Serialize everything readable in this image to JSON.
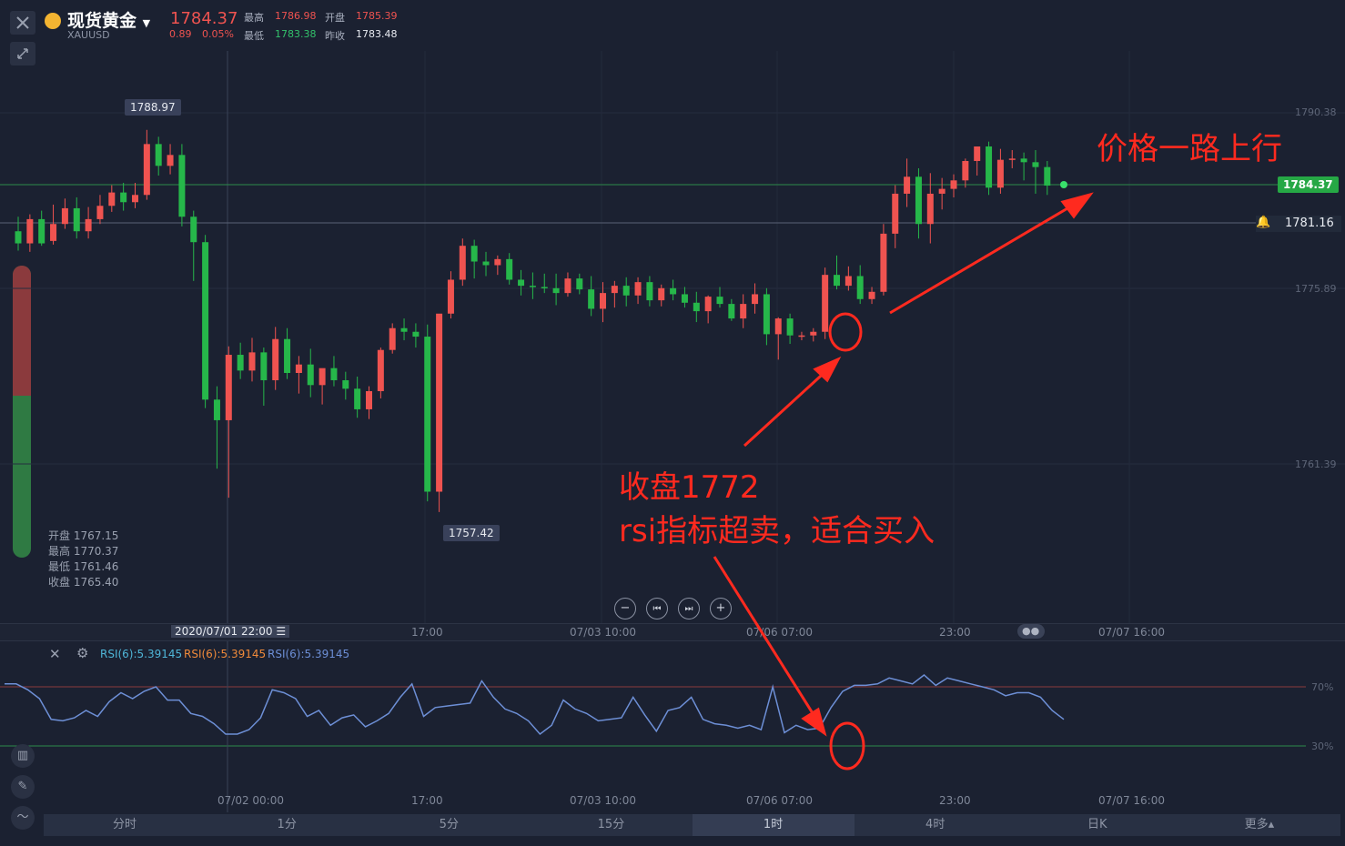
{
  "header": {
    "name": "现货黄金",
    "symbol": "XAUUSD",
    "price": "1784.37",
    "change": "0.89",
    "change_pct": "0.05%",
    "high_label": "最高",
    "high": "1786.98",
    "open_label": "开盘",
    "open": "1785.39",
    "low_label": "最低",
    "low": "1783.38",
    "prev_label": "昨收",
    "prev": "1783.48"
  },
  "price_axis": [
    "1790.38",
    "1775.89",
    "1761.39"
  ],
  "tags": {
    "high_marker": "1788.97",
    "low_marker": "1757.42",
    "current": "1784.37",
    "alert": "1781.16"
  },
  "ohlc_panel": {
    "open": "开盘 1767.15",
    "high": "最高 1770.37",
    "low": "最低 1761.46",
    "close": "收盘 1765.40"
  },
  "crosshair_time": "2020/07/01 22:00",
  "time_axis_top": [
    "17:00",
    "07/03 10:00",
    "07/06 07:00",
    "23:00",
    "07/07 16:00"
  ],
  "time_axis_bottom": [
    "07/02 00:00",
    "17:00",
    "07/03 10:00",
    "07/06 07:00",
    "23:00",
    "07/07 16:00"
  ],
  "rsi": {
    "label1": "RSI(6):5.39145",
    "label2": "RSI(6):5.39145",
    "label3": "RSI(6):5.39145",
    "level_high": "70%",
    "level_low": "30%"
  },
  "annotations": {
    "trend": "价格一路上行",
    "close": "收盘1772",
    "rsi_note": "rsi指标超卖，适合买入"
  },
  "timeframes": [
    "分时",
    "1分",
    "5分",
    "15分",
    "1时",
    "4时",
    "日K",
    "更多▴"
  ],
  "active_timeframe": "1时",
  "colors": {
    "up": "#ef5350",
    "down": "#26b74a",
    "bg": "#1b2131",
    "annotation": "#ff2a1f",
    "rsi_line": "#6d8fd6"
  },
  "chart_data": {
    "type": "candlestick",
    "ohlc": [
      [
        1780.6,
        1781.8,
        1779.0,
        1779.6
      ],
      [
        1779.6,
        1782.0,
        1778.9,
        1781.6
      ],
      [
        1781.6,
        1782.3,
        1779.4,
        1779.6
      ],
      [
        1779.8,
        1782.8,
        1779.5,
        1781.2
      ],
      [
        1781.2,
        1783.3,
        1780.8,
        1782.5
      ],
      [
        1782.5,
        1783.4,
        1780.0,
        1780.6
      ],
      [
        1780.6,
        1782.6,
        1780.0,
        1781.6
      ],
      [
        1781.6,
        1783.6,
        1781.2,
        1782.7
      ],
      [
        1782.7,
        1784.4,
        1782.2,
        1783.8
      ],
      [
        1783.8,
        1784.6,
        1782.3,
        1783.0
      ],
      [
        1783.0,
        1784.6,
        1782.5,
        1783.6
      ],
      [
        1783.6,
        1788.97,
        1783.2,
        1787.8
      ],
      [
        1787.8,
        1788.4,
        1785.2,
        1786.0
      ],
      [
        1786.0,
        1787.8,
        1785.3,
        1786.9
      ],
      [
        1786.9,
        1787.8,
        1781.0,
        1781.8
      ],
      [
        1781.8,
        1782.3,
        1776.5,
        1779.7
      ],
      [
        1779.7,
        1780.3,
        1766.0,
        1766.7
      ],
      [
        1766.7,
        1767.8,
        1761.0,
        1765.0
      ],
      [
        1765.0,
        1771.1,
        1758.6,
        1770.4
      ],
      [
        1770.4,
        1771.4,
        1768.4,
        1769.1
      ],
      [
        1769.1,
        1771.8,
        1768.2,
        1770.6
      ],
      [
        1770.6,
        1771.0,
        1766.2,
        1768.3
      ],
      [
        1768.3,
        1772.7,
        1767.5,
        1771.7
      ],
      [
        1771.7,
        1772.6,
        1768.4,
        1768.9
      ],
      [
        1768.9,
        1770.3,
        1767.2,
        1769.6
      ],
      [
        1769.6,
        1770.9,
        1766.9,
        1767.9
      ],
      [
        1767.9,
        1769.2,
        1766.3,
        1769.3
      ],
      [
        1769.3,
        1770.3,
        1767.8,
        1768.3
      ],
      [
        1768.3,
        1769.0,
        1766.7,
        1767.6
      ],
      [
        1767.6,
        1768.6,
        1765.2,
        1765.9
      ],
      [
        1765.9,
        1767.8,
        1765.1,
        1767.4
      ],
      [
        1767.4,
        1771.0,
        1766.8,
        1770.8
      ],
      [
        1770.8,
        1773.0,
        1770.5,
        1772.6
      ],
      [
        1772.6,
        1773.4,
        1771.6,
        1772.3
      ],
      [
        1772.3,
        1773.0,
        1771.0,
        1771.9
      ],
      [
        1771.9,
        1772.9,
        1758.3,
        1759.1
      ],
      [
        1759.1,
        1773.6,
        1757.42,
        1773.8
      ],
      [
        1773.8,
        1777.3,
        1773.4,
        1776.6
      ],
      [
        1776.6,
        1780.0,
        1776.1,
        1779.4
      ],
      [
        1779.4,
        1779.9,
        1776.7,
        1778.1
      ],
      [
        1778.1,
        1778.9,
        1776.9,
        1777.8
      ],
      [
        1777.8,
        1778.6,
        1777.0,
        1778.3
      ],
      [
        1778.3,
        1778.8,
        1776.2,
        1776.6
      ],
      [
        1776.6,
        1777.4,
        1775.3,
        1776.1
      ],
      [
        1776.1,
        1777.2,
        1775.0,
        1776.0
      ],
      [
        1776.0,
        1777.1,
        1775.5,
        1775.9
      ],
      [
        1775.9,
        1777.1,
        1774.5,
        1775.5
      ],
      [
        1775.5,
        1777.2,
        1775.2,
        1776.7
      ],
      [
        1776.7,
        1777.1,
        1775.4,
        1775.8
      ],
      [
        1775.8,
        1776.9,
        1773.6,
        1774.2
      ],
      [
        1774.2,
        1776.4,
        1773.1,
        1775.5
      ],
      [
        1775.5,
        1776.5,
        1774.3,
        1776.1
      ],
      [
        1776.1,
        1776.8,
        1774.4,
        1775.3
      ],
      [
        1775.3,
        1776.8,
        1774.6,
        1776.4
      ],
      [
        1776.4,
        1776.9,
        1774.4,
        1774.9
      ],
      [
        1774.9,
        1776.2,
        1774.4,
        1775.9
      ],
      [
        1775.9,
        1776.6,
        1774.9,
        1775.4
      ],
      [
        1775.4,
        1776.0,
        1774.3,
        1774.7
      ],
      [
        1774.7,
        1775.6,
        1773.1,
        1774.0
      ],
      [
        1774.0,
        1775.3,
        1773.0,
        1775.2
      ],
      [
        1775.2,
        1776.0,
        1774.3,
        1774.6
      ],
      [
        1774.6,
        1775.0,
        1773.2,
        1773.4
      ],
      [
        1773.4,
        1775.4,
        1772.6,
        1774.6
      ],
      [
        1774.6,
        1776.3,
        1773.8,
        1775.4
      ],
      [
        1775.4,
        1775.9,
        1771.2,
        1772.1
      ],
      [
        1772.1,
        1773.5,
        1770.0,
        1773.4
      ],
      [
        1773.4,
        1773.8,
        1771.3,
        1772.0
      ],
      [
        1772.0,
        1772.3,
        1771.6,
        1772.0
      ],
      [
        1772.0,
        1772.6,
        1771.5,
        1772.3
      ],
      [
        1772.3,
        1777.6,
        1771.7,
        1777.0
      ],
      [
        1777.0,
        1778.6,
        1775.8,
        1776.1
      ],
      [
        1776.1,
        1777.7,
        1775.7,
        1776.9
      ],
      [
        1776.9,
        1777.8,
        1774.6,
        1775.0
      ],
      [
        1775.0,
        1776.0,
        1774.6,
        1775.6
      ],
      [
        1775.6,
        1781.2,
        1775.3,
        1780.4
      ],
      [
        1780.4,
        1784.4,
        1779.2,
        1783.7
      ],
      [
        1783.7,
        1786.6,
        1782.6,
        1785.1
      ],
      [
        1785.1,
        1785.8,
        1780.0,
        1781.2
      ],
      [
        1781.2,
        1785.4,
        1779.6,
        1783.7
      ],
      [
        1783.7,
        1785.0,
        1782.4,
        1784.1
      ],
      [
        1784.1,
        1785.3,
        1783.4,
        1784.8
      ],
      [
        1784.8,
        1786.6,
        1784.2,
        1786.4
      ],
      [
        1786.4,
        1787.1,
        1785.2,
        1787.6
      ],
      [
        1787.6,
        1788.0,
        1783.6,
        1784.2
      ],
      [
        1784.2,
        1787.4,
        1783.7,
        1786.5
      ],
      [
        1786.5,
        1787.3,
        1785.8,
        1786.6
      ],
      [
        1786.6,
        1787.1,
        1784.8,
        1786.3
      ],
      [
        1786.3,
        1787.3,
        1783.7,
        1785.9
      ],
      [
        1785.9,
        1786.4,
        1783.6,
        1784.37
      ]
    ],
    "rsi": [
      72,
      72,
      68,
      62,
      48,
      47,
      49,
      54,
      50,
      60,
      66,
      62,
      67,
      70,
      61,
      61,
      52,
      50,
      45,
      38,
      38,
      41,
      49,
      68,
      66,
      62,
      50,
      54,
      44,
      49,
      51,
      43,
      47,
      52,
      63,
      72,
      50,
      56,
      57,
      58,
      59,
      74,
      63,
      55,
      52,
      47,
      38,
      44,
      61,
      55,
      52,
      47,
      48,
      49,
      63,
      51,
      40,
      54,
      56,
      63,
      48,
      45,
      44,
      42,
      44,
      41,
      70,
      39,
      44,
      41,
      42,
      56,
      67,
      71,
      71,
      72,
      76,
      74,
      72,
      78,
      71,
      76,
      74,
      72,
      70,
      68,
      64,
      66,
      66,
      63,
      54,
      48
    ]
  }
}
